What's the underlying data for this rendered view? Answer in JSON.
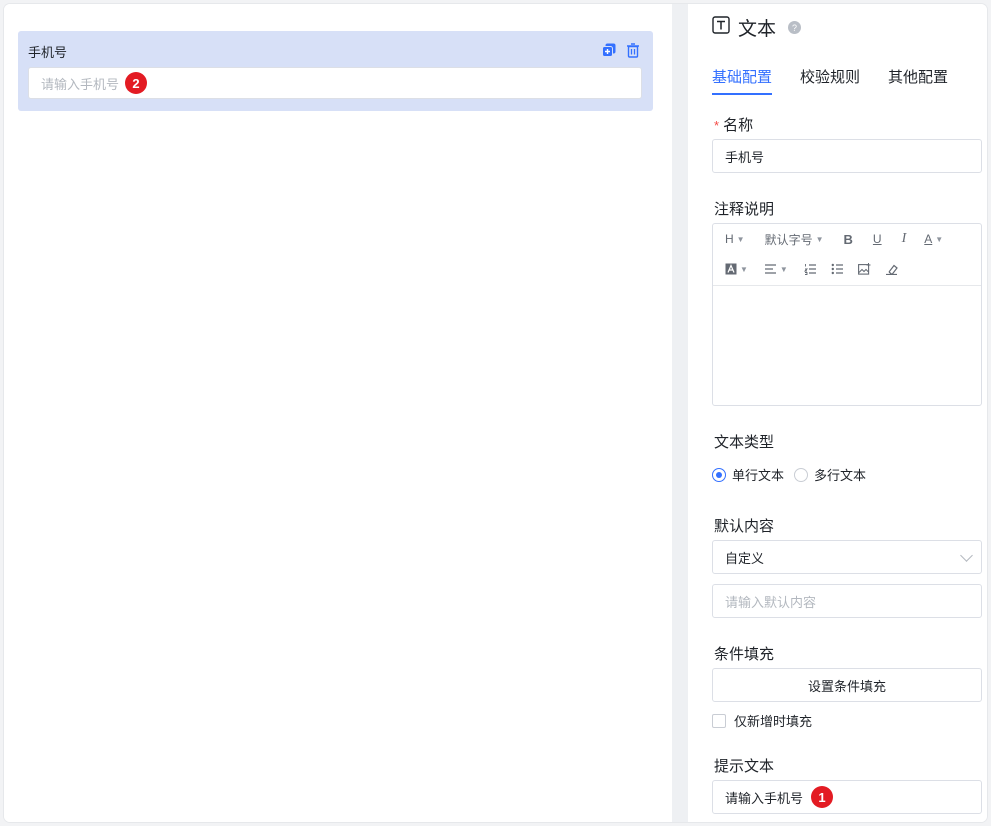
{
  "canvas": {
    "field": {
      "label": "手机号",
      "placeholder": "请输入手机号",
      "marker": "2",
      "icons": [
        "copy-icon",
        "trash-icon"
      ]
    }
  },
  "panel": {
    "title": "文本",
    "help_icon": "?",
    "tabs": [
      {
        "label": "基础配置",
        "active": true
      },
      {
        "label": "校验规则",
        "active": false
      },
      {
        "label": "其他配置",
        "active": false
      }
    ],
    "name": {
      "required_mark": "*",
      "label": "名称",
      "value": "手机号"
    },
    "description": {
      "label": "注释说明",
      "toolbar": {
        "heading": "H",
        "font_size": "默认字号",
        "bold": "B",
        "underline": "U",
        "italic": "I",
        "font_color": "A"
      }
    },
    "text_type": {
      "label": "文本类型",
      "options": [
        {
          "label": "单行文本",
          "selected": true
        },
        {
          "label": "多行文本",
          "selected": false
        }
      ]
    },
    "default_content": {
      "label": "默认内容",
      "select_value": "自定义",
      "input_placeholder": "请输入默认内容"
    },
    "conditional_fill": {
      "label": "条件填充",
      "button": "设置条件填充",
      "checkbox_label": "仅新增时填充"
    },
    "hint_text": {
      "label": "提示文本",
      "value": "请输入手机号",
      "marker": "1"
    }
  },
  "colors": {
    "accent": "#3370ff",
    "card_bg": "#d7e0f7",
    "marker": "#e31b23"
  }
}
